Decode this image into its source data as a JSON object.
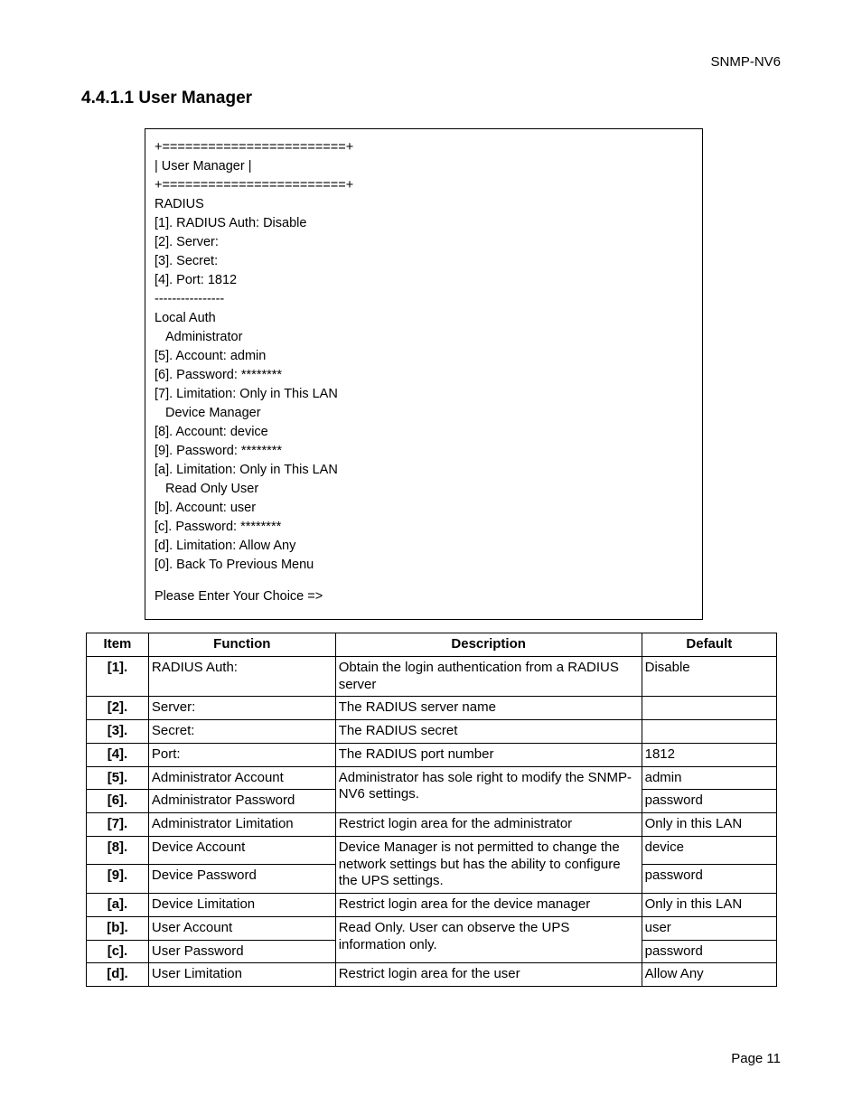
{
  "doc_id": "SNMP-NV6",
  "section_heading": "4.4.1.1 User Manager",
  "terminal": {
    "border_top": "+========================+",
    "title_line": "|       User Manager       |",
    "border_bot": "+========================+",
    "radius_header": "RADIUS",
    "radius_lines": [
      "[1]. RADIUS Auth: Disable",
      "[2]. Server:",
      "[3]. Secret:",
      "[4]. Port: 1812"
    ],
    "divider": "----------------",
    "local_auth": "Local Auth",
    "admin_header": "Administrator",
    "admin_lines": [
      "[5]. Account: admin",
      "[6]. Password: ********",
      "[7]. Limitation: Only in This LAN"
    ],
    "device_header": "Device Manager",
    "device_lines": [
      "[8]. Account: device",
      "[9]. Password: ********",
      "[a]. Limitation: Only in This LAN"
    ],
    "user_header": "Read Only User",
    "user_lines": [
      "[b]. Account: user",
      "[c]. Password: ********",
      "[d]. Limitation: Allow Any",
      "[0]. Back To Previous Menu"
    ],
    "prompt": "Please Enter Your Choice =>"
  },
  "table": {
    "headers": {
      "item": "Item",
      "function": "Function",
      "description": "Description",
      "default": "Default"
    },
    "rows": [
      {
        "item": "[1].",
        "function": "RADIUS Auth:",
        "description": "Obtain the login authentication from a RADIUS server",
        "default": "Disable"
      },
      {
        "item": "[2].",
        "function": "Server:",
        "description": "The RADIUS server name",
        "default": ""
      },
      {
        "item": "[3].",
        "function": "Secret:",
        "description": "The RADIUS secret",
        "default": ""
      },
      {
        "item": "[4].",
        "function": "Port:",
        "description": "The RADIUS port number",
        "default": "1812"
      },
      {
        "item": "[5].",
        "function": "Administrator Account",
        "default": "admin",
        "desc_shared": "Administrator has sole right to modify the SNMP-NV6 settings.",
        "desc_rowspan": 2
      },
      {
        "item": "[6].",
        "function": "Administrator Password",
        "default": "password"
      },
      {
        "item": "[7].",
        "function": "Administrator Limitation",
        "description": "Restrict login area for the administrator",
        "default": "Only in this LAN"
      },
      {
        "item": "[8].",
        "function": "Device Account",
        "default": "device",
        "desc_shared": "Device Manager is not permitted to change the network settings but has the ability to configure the UPS settings.",
        "desc_rowspan": 2
      },
      {
        "item": "[9].",
        "function": "Device Password",
        "default": "password"
      },
      {
        "item": "[a].",
        "function": "Device Limitation",
        "description": "Restrict login area for the device manager",
        "default": "Only in this LAN"
      },
      {
        "item": "[b].",
        "function": "User Account",
        "default": "user",
        "desc_shared": "Read Only. User can observe the UPS information only.",
        "desc_rowspan": 2
      },
      {
        "item": "[c].",
        "function": "User Password",
        "default": "password"
      },
      {
        "item": "[d].",
        "function": "User Limitation",
        "description": "Restrict login area for the user",
        "default": "Allow Any"
      }
    ]
  },
  "page_label": "Page 11"
}
